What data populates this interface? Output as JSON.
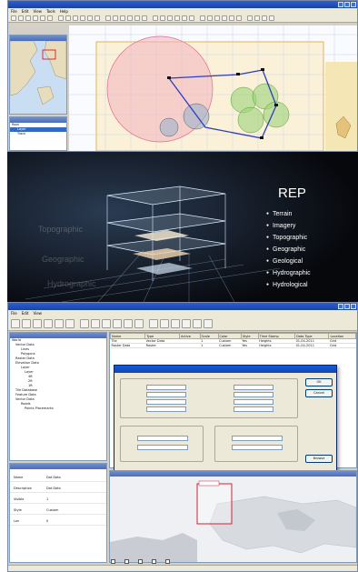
{
  "panel1": {
    "title": "",
    "menus": [
      "File",
      "Edit",
      "View",
      "Tools",
      "Help"
    ],
    "layers_title": "",
    "tree": [
      "Root",
      "Layer",
      "Track"
    ]
  },
  "panel2": {
    "title": "REP",
    "list": [
      "Terrain",
      "Imagery",
      "Topographic",
      "Geographic",
      "Geological",
      "Hydrographic",
      "Hydrological"
    ]
  },
  "panel3": {
    "title": "",
    "menus": [
      "File",
      "Edit",
      "View"
    ],
    "tree": [
      "World",
      "Vector Data",
      "Lines",
      "Polygons",
      "Raster Data",
      "Elevation Data",
      "Layer",
      "Layer",
      "4ft",
      "2ft",
      "1ft",
      "Tile Database",
      "Feature Data",
      "Vector Data",
      "Roads",
      "Points Placemarks"
    ],
    "table": {
      "headers": [
        "Name",
        "Type",
        "Active",
        "Scale",
        "Color",
        "Style",
        "Time Stamp",
        "Data Type",
        "Location"
      ],
      "rows": [
        [
          "Tile",
          "Vector Data",
          "",
          "1",
          "Custom",
          "Yes",
          "Heights",
          "01-04-2011",
          "Grid"
        ],
        [
          "Raster Data",
          "Raster",
          "",
          "1",
          "Custom",
          "Yes",
          "Heights",
          "01-04-2011",
          "Grid"
        ]
      ]
    },
    "dialog": {
      "title": "",
      "ok": "OK",
      "cancel": "Cancel",
      "browse": "Browse"
    },
    "props": [
      {
        "k": "Name",
        "v": "Dat Data"
      },
      {
        "k": "Description",
        "v": "Dat Data"
      },
      {
        "k": "Visible",
        "v": "1"
      },
      {
        "k": "Style",
        "v": "Custom"
      },
      {
        "k": "Lon",
        "v": "0"
      }
    ]
  },
  "colors": {
    "accent": "#316ac5",
    "titlebar": "#1b43a8",
    "chrome": "#ece9d8",
    "circle_fill": "#f3b2c0",
    "zone_green": "#9ed37a",
    "route": "#2b3ec4"
  }
}
